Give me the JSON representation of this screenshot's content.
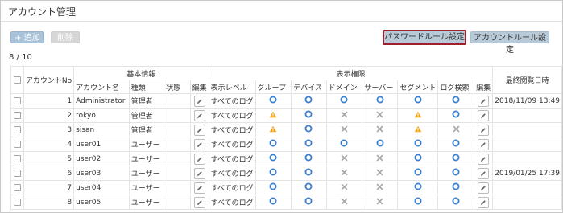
{
  "page": {
    "title": "アカウント管理"
  },
  "toolbar": {
    "add_label": "+ 追加",
    "delete_label": "削除",
    "password_rule_label": "パスワードルール設定",
    "account_rule_label": "アカウントルール設定"
  },
  "counter": "8 / 10",
  "table": {
    "headers": {
      "account_no": "アカウントNo",
      "basic_info": "基本情報",
      "display_permission": "表示権限",
      "last_viewed": "最終閲覧日時",
      "account_name": "アカウント名",
      "type": "種類",
      "status": "状態",
      "edit_basic": "編集",
      "display_level": "表示レベル",
      "group": "グループ",
      "device": "デバイス",
      "domain": "ドメイン",
      "server": "サーバー",
      "segment": "セグメント",
      "log_search": "ログ検索",
      "edit_perm": "編集"
    },
    "rows": [
      {
        "no": "1",
        "name": "Administrator",
        "type": "管理者",
        "status": "",
        "level": "すべてのログ",
        "perms": [
          "circle",
          "circle",
          "circle",
          "circle",
          "circle",
          "circle"
        ],
        "last": "2018/11/09 13:49"
      },
      {
        "no": "2",
        "name": "tokyo",
        "type": "管理者",
        "status": "",
        "level": "すべてのログ",
        "perms": [
          "warning",
          "circle",
          "cross",
          "cross",
          "warning",
          "circle"
        ],
        "last": ""
      },
      {
        "no": "3",
        "name": "sisan",
        "type": "管理者",
        "status": "",
        "level": "すべてのログ",
        "perms": [
          "warning",
          "circle",
          "cross",
          "cross",
          "warning",
          "cross"
        ],
        "last": ""
      },
      {
        "no": "4",
        "name": "user01",
        "type": "ユーザー",
        "status": "",
        "level": "すべてのログ",
        "perms": [
          "circle",
          "circle",
          "circle",
          "circle",
          "circle",
          "circle"
        ],
        "last": ""
      },
      {
        "no": "5",
        "name": "user02",
        "type": "ユーザー",
        "status": "",
        "level": "すべてのログ",
        "perms": [
          "circle",
          "circle",
          "cross",
          "cross",
          "circle",
          "circle"
        ],
        "last": ""
      },
      {
        "no": "6",
        "name": "user03",
        "type": "ユーザー",
        "status": "",
        "level": "すべてのログ",
        "perms": [
          "circle",
          "circle",
          "cross",
          "cross",
          "circle",
          "circle"
        ],
        "last": "2019/01/25 17:39"
      },
      {
        "no": "7",
        "name": "user04",
        "type": "ユーザー",
        "status": "",
        "level": "すべてのログ",
        "perms": [
          "circle",
          "circle",
          "cross",
          "cross",
          "circle",
          "circle"
        ],
        "last": ""
      },
      {
        "no": "8",
        "name": "user05",
        "type": "ユーザー",
        "status": "",
        "level": "すべてのログ",
        "perms": [
          "circle",
          "circle",
          "cross",
          "cross",
          "circle",
          "circle"
        ],
        "last": ""
      }
    ]
  },
  "icons": {
    "circle": "circle-icon",
    "cross": "cross-icon",
    "warning": "warning-icon",
    "edit": "pencil-icon"
  },
  "colors": {
    "circle": "#3b7fd0",
    "cross": "#a8a8a8",
    "warning": "#f0a81c",
    "highlight_border": "#a0202a",
    "button_blue": "#b8c9d8"
  }
}
